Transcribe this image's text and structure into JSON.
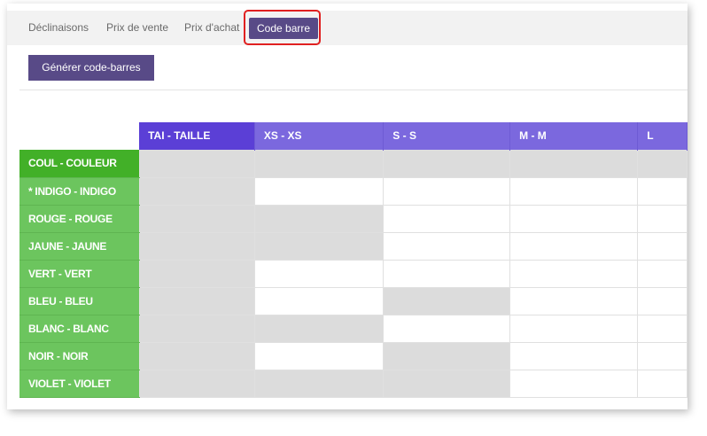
{
  "tabs": [
    {
      "label": "Déclinaisons",
      "active": false
    },
    {
      "label": "Prix de vente",
      "active": false
    },
    {
      "label": "Prix d'achat",
      "active": false
    },
    {
      "label": "Code barre",
      "active": true
    }
  ],
  "generate_button_label": "Générer code-barres",
  "matrix": {
    "column_headers": [
      "TAI - TAILLE",
      "XS - XS",
      "S - S",
      "M - M",
      "L"
    ],
    "row_headers": [
      "COUL - COULEUR",
      "* INDIGO - INDIGO",
      "ROUGE - ROUGE",
      "JAUNE - JAUNE",
      "VERT - VERT",
      "BLEU - BLEU",
      "BLANC - BLANC",
      "NOIR - NOIR",
      "VIOLET - VIOLET"
    ],
    "cell_states": [
      [
        "disabled",
        "disabled",
        "disabled",
        "disabled",
        "disabled"
      ],
      [
        "disabled",
        "enabled",
        "enabled",
        "enabled",
        "enabled"
      ],
      [
        "disabled",
        "disabled",
        "enabled",
        "enabled",
        "enabled"
      ],
      [
        "disabled",
        "disabled",
        "enabled",
        "enabled",
        "enabled"
      ],
      [
        "disabled",
        "enabled",
        "enabled",
        "enabled",
        "enabled"
      ],
      [
        "disabled",
        "enabled",
        "disabled",
        "enabled",
        "enabled"
      ],
      [
        "disabled",
        "disabled",
        "enabled",
        "enabled",
        "enabled"
      ],
      [
        "disabled",
        "enabled",
        "disabled",
        "enabled",
        "enabled"
      ],
      [
        "disabled",
        "disabled",
        "disabled",
        "enabled",
        "enabled"
      ]
    ]
  },
  "colors": {
    "primary_button": "#584a87",
    "column_header": "#7b68de",
    "column_header_first": "#5b3fd6",
    "row_header": "#6cc55e",
    "row_header_first": "#42b028",
    "disabled_cell": "#dcdcdc",
    "tab_highlight": "#e02020"
  }
}
